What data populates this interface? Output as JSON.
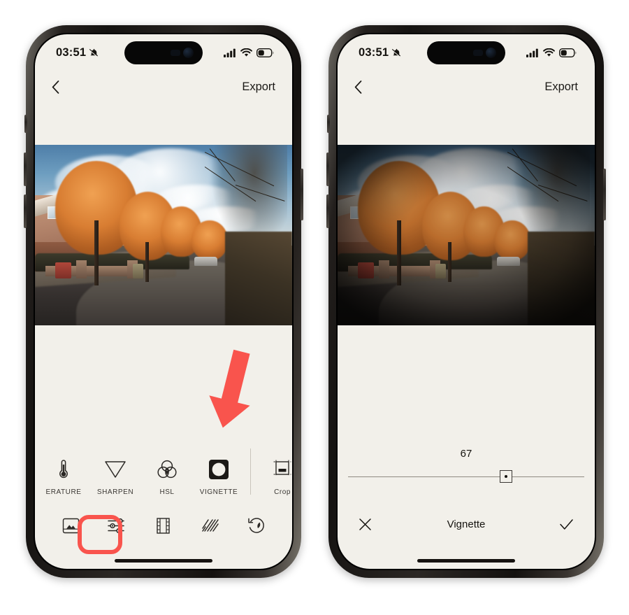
{
  "annotation": {
    "arrow_color": "#f9544d",
    "highlight_color": "#f9544d",
    "arrow_name": "red-down-arrow",
    "highlight_target": "adjust-tab"
  },
  "theme": {
    "screen_bg": "#f2f0ea",
    "text_color": "#15130f",
    "accent": "#f9544d"
  },
  "phones": [
    {
      "id": "left",
      "status_bar": {
        "time": "03:51",
        "silent_icon": "bell-slash-icon",
        "cellular_icon": "signal-bars-icon",
        "wifi_icon": "wifi-icon",
        "battery_icon": "battery-icon"
      },
      "navbar": {
        "back_icon": "chevron-left-icon",
        "export_label": "Export"
      },
      "photo": {
        "alt": "autumn-street-scene",
        "vignette_applied": false
      },
      "tools": [
        {
          "label": "ERATURE",
          "icon": "thermometer-icon",
          "name": "tool-temperature"
        },
        {
          "label": "SHARPEN",
          "icon": "triangle-down-icon",
          "name": "tool-sharpen"
        },
        {
          "label": "HSL",
          "icon": "three-circles-icon",
          "name": "tool-hsl"
        },
        {
          "label": "VIGNETTE",
          "icon": "vignette-square-icon",
          "name": "tool-vignette"
        },
        {
          "label": "Crop",
          "icon": "crop-icon",
          "name": "tool-crop"
        }
      ],
      "tabs": [
        {
          "icon": "photo-icon",
          "name": "tab-presets",
          "active": false
        },
        {
          "icon": "sliders-icon",
          "name": "tab-adjust",
          "active": true
        },
        {
          "icon": "film-strip-icon",
          "name": "tab-film",
          "active": false
        },
        {
          "icon": "grain-icon",
          "name": "tab-grain",
          "active": false
        },
        {
          "icon": "history-icon",
          "name": "tab-history",
          "active": false
        }
      ]
    },
    {
      "id": "right",
      "status_bar": {
        "time": "03:51",
        "silent_icon": "bell-slash-icon",
        "cellular_icon": "signal-bars-icon",
        "wifi_icon": "wifi-icon",
        "battery_icon": "battery-icon"
      },
      "navbar": {
        "back_icon": "chevron-left-icon",
        "export_label": "Export"
      },
      "photo": {
        "alt": "autumn-street-scene-vignetted",
        "vignette_applied": true
      },
      "slider": {
        "value": "67",
        "min": 0,
        "max": 100,
        "percent": 67,
        "knob_icon": "square-dot-handle"
      },
      "confirm": {
        "cancel_icon": "close-icon",
        "title": "Vignette",
        "accept_icon": "check-icon"
      }
    }
  ]
}
